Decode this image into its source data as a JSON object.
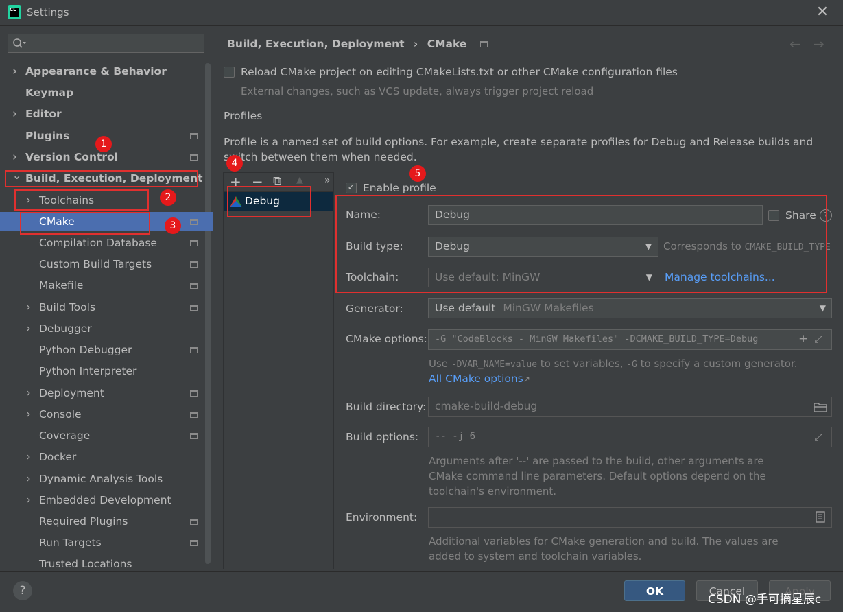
{
  "window": {
    "title": "Settings",
    "app_badge": "CL"
  },
  "search": {
    "placeholder": ""
  },
  "sidebar": {
    "items": [
      {
        "label": "Appearance & Behavior",
        "expanded": false,
        "bold": true
      },
      {
        "label": "Keymap",
        "bold": true
      },
      {
        "label": "Editor",
        "expanded": false,
        "bold": true
      },
      {
        "label": "Plugins",
        "bold": true
      },
      {
        "label": "Version Control",
        "expanded": false,
        "bold": true
      },
      {
        "label": "Build, Execution, Deployment",
        "expanded": true,
        "bold": true
      },
      {
        "label": "Toolchains",
        "expanded": false
      },
      {
        "label": "CMake",
        "selected": true
      },
      {
        "label": "Compilation Database"
      },
      {
        "label": "Custom Build Targets"
      },
      {
        "label": "Makefile"
      },
      {
        "label": "Build Tools",
        "expanded": false
      },
      {
        "label": "Debugger",
        "expanded": false
      },
      {
        "label": "Python Debugger"
      },
      {
        "label": "Python Interpreter"
      },
      {
        "label": "Deployment",
        "expanded": false
      },
      {
        "label": "Console",
        "expanded": false
      },
      {
        "label": "Coverage"
      },
      {
        "label": "Docker",
        "expanded": false
      },
      {
        "label": "Dynamic Analysis Tools",
        "expanded": false
      },
      {
        "label": "Embedded Development",
        "expanded": false
      },
      {
        "label": "Required Plugins"
      },
      {
        "label": "Run Targets"
      },
      {
        "label": "Trusted Locations"
      }
    ]
  },
  "breadcrumb": {
    "parent": "Build, Execution, Deployment",
    "separator": "›",
    "current": "CMake"
  },
  "reload": {
    "label": "Reload CMake project on editing CMakeLists.txt or other CMake configuration files",
    "hint": "External changes, such as VCS update, always trigger project reload",
    "checked": false
  },
  "profiles": {
    "section_title": "Profiles",
    "description": "Profile is a named set of build options. For example, create separate profiles for Debug and Release builds and switch between them when needed.",
    "toolbar": {
      "add": "+",
      "remove": "−",
      "copy": "⧉",
      "up": "▲",
      "more": "»"
    },
    "list": [
      "Debug"
    ]
  },
  "form": {
    "enable_profile": {
      "label": "Enable profile",
      "checked": true
    },
    "name": {
      "label": "Name:",
      "value": "Debug"
    },
    "share": {
      "label": "Share",
      "checked": false,
      "help": "?"
    },
    "build_type": {
      "label": "Build type:",
      "value": "Debug",
      "hint_prefix": "Corresponds to ",
      "hint_code": "CMAKE_BUILD_TYPE"
    },
    "toolchain": {
      "label": "Toolchain:",
      "value": "Use default: MinGW",
      "link": "Manage toolchains..."
    },
    "generator": {
      "label": "Generator:",
      "value": "Use default",
      "value_hint": "MinGW Makefiles"
    },
    "cmake_options": {
      "label": "CMake options:",
      "value": "-G \"CodeBlocks - MinGW Makefiles\" -DCMAKE_BUILD_TYPE=Debug",
      "hint_1": "Use ",
      "hint_code_1": "-DVAR_NAME=value",
      "hint_2": " to set variables, ",
      "hint_code_2": "-G",
      "hint_3": " to specify a custom generator.",
      "link": "All CMake options"
    },
    "build_directory": {
      "label": "Build directory:",
      "value": "cmake-build-debug"
    },
    "build_options": {
      "label": "Build options:",
      "value": "-- -j 6",
      "hint_line1": "Arguments after '--' are passed to the build, other arguments are",
      "hint_line2": "CMake command line parameters. Default options depend on the",
      "hint_line3": "toolchain's environment."
    },
    "environment": {
      "label": "Environment:",
      "value": "",
      "hint_line1": "Additional variables for CMake generation and build. The values are",
      "hint_line2": "added to system and toolchain variables."
    }
  },
  "annotations": [
    "1",
    "2",
    "3",
    "4",
    "5"
  ],
  "buttons": {
    "ok": "OK",
    "cancel": "Cancel",
    "apply": "Apply",
    "help": "?"
  },
  "watermark": "CSDN @手可摘星辰c",
  "colors": {
    "accent": "#4b6eaf",
    "annotation_red": "#e5191b",
    "link": "#589df6",
    "ok_button": "#365880"
  }
}
